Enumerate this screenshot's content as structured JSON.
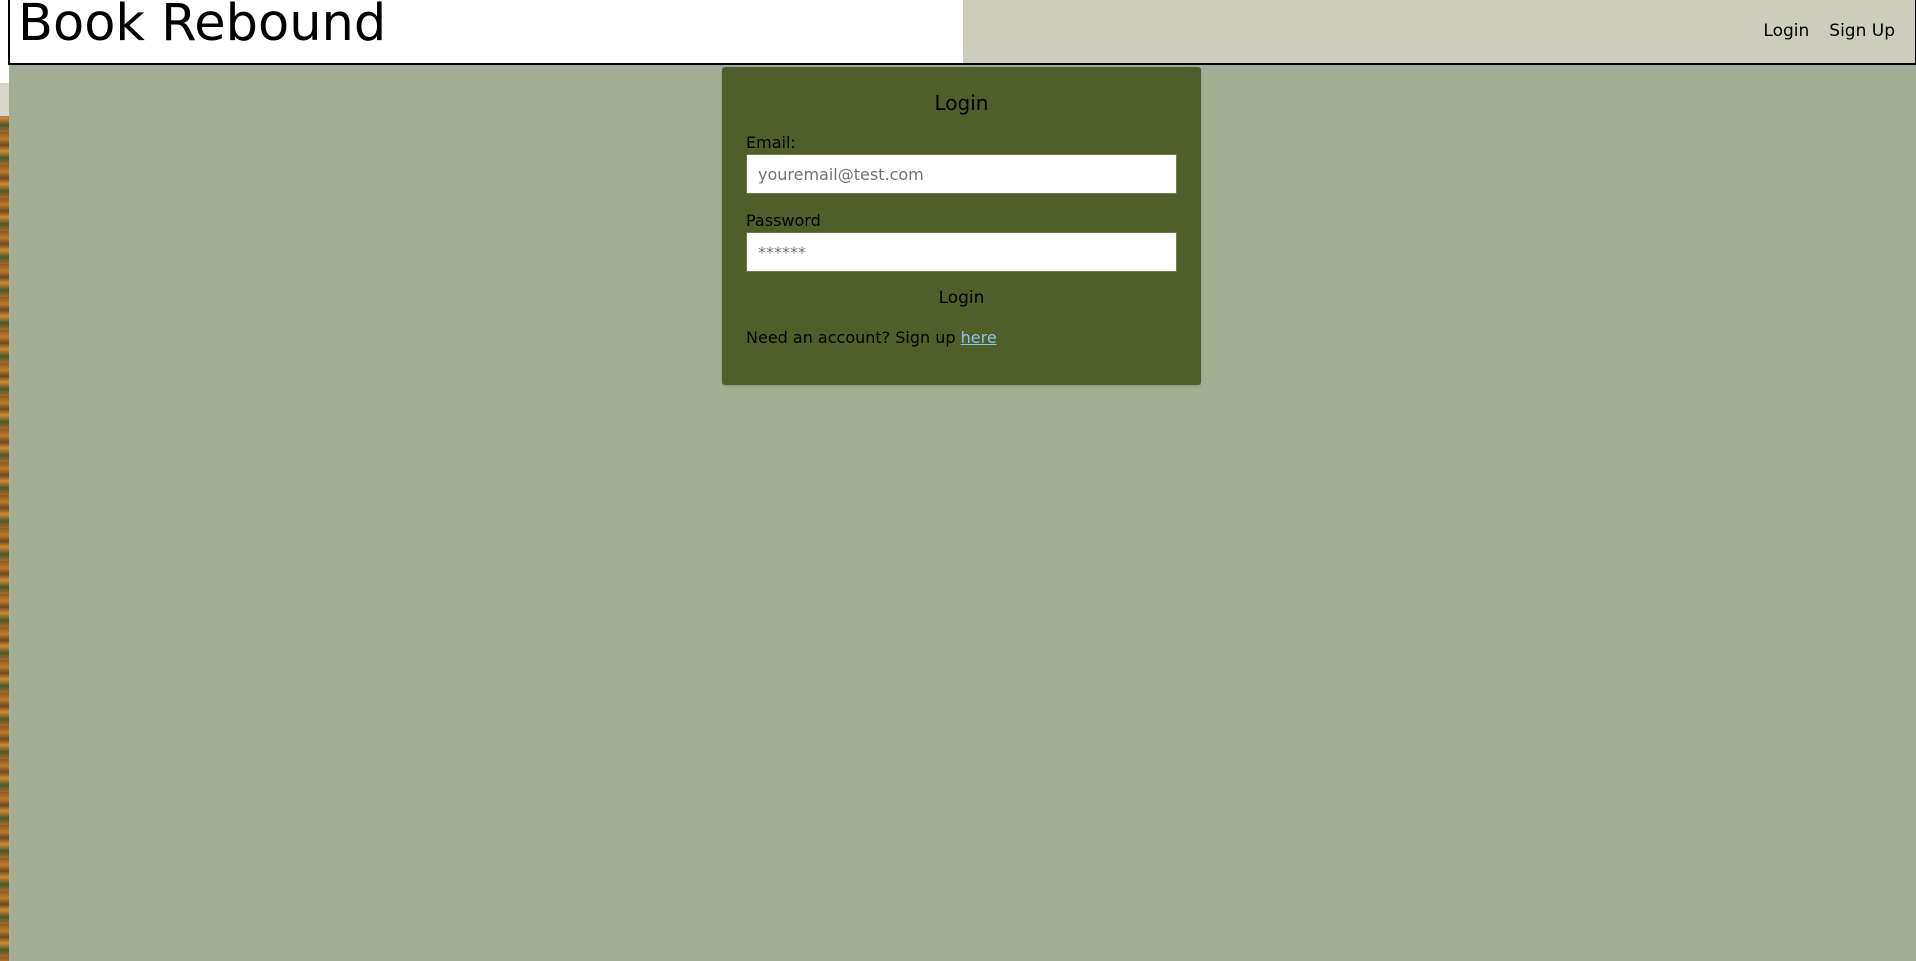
{
  "header": {
    "title": "Book Rebound",
    "nav": {
      "login_label": "Login",
      "signup_label": "Sign Up"
    }
  },
  "login_form": {
    "title": "Login",
    "email_label": "Email:",
    "email_placeholder": "youremail@test.com",
    "email_value": "",
    "password_label": "Password",
    "password_placeholder": "******",
    "password_value": "",
    "submit_label": "Login",
    "signup_prompt": "Need an account? Sign up",
    "signup_link_label": "here"
  },
  "colors": {
    "page_background": "#a2ad94",
    "header_background": "#cccdbd",
    "card_background": "#505e2a",
    "link": "#8fc4ea"
  }
}
